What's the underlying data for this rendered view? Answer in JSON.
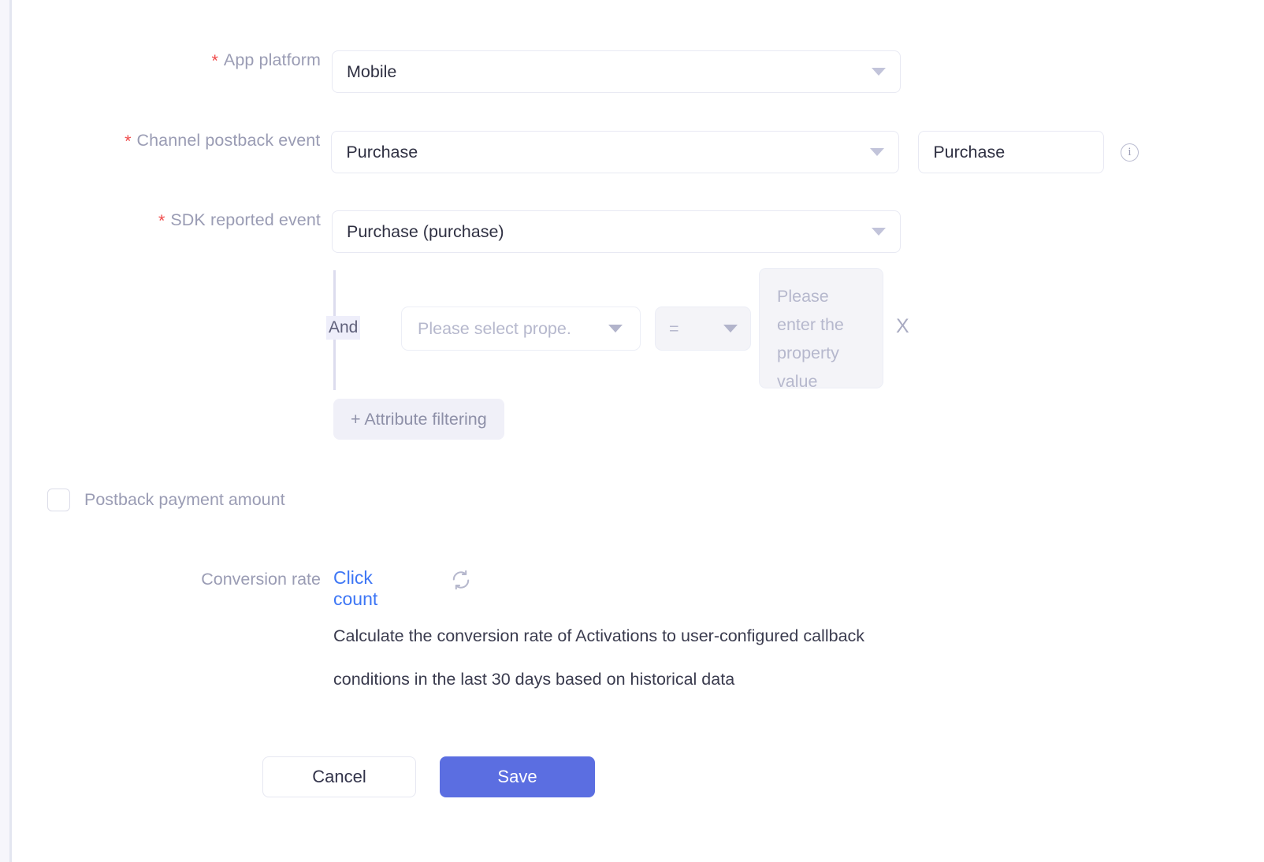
{
  "theme": {
    "accent": "#5b6ee1",
    "link": "#3d76f5",
    "required_star": "#f04a4a",
    "label_text": "#9a9cb4",
    "body_text": "#3a3b4e",
    "border": "#e8e9f3",
    "muted_fill": "#f4f4f8",
    "badge_fill": "#eeeefa"
  },
  "form": {
    "app_platform": {
      "label": "App platform",
      "required": true,
      "star": "*",
      "value": "Mobile",
      "caret_icon": "chevron-down-icon"
    },
    "channel_postback_event": {
      "label": "Channel postback event",
      "required": true,
      "star": "*",
      "value": "Purchase",
      "caret_icon": "chevron-down-icon",
      "alias_value": "Purchase",
      "alias_placeholder": "Purchase",
      "info_icon": "info-icon",
      "info_glyph": "i"
    },
    "sdk_reported_event": {
      "label": "SDK reported event",
      "required": true,
      "star": "*",
      "value": "Purchase (purchase)",
      "caret_icon": "chevron-down-icon"
    },
    "attribute_filter": {
      "conjunction": "And",
      "property_placeholder": "Please select prope.",
      "property_caret_icon": "chevron-down-icon",
      "operator_value": "=",
      "operator_caret_icon": "chevron-down-icon",
      "value_placeholder": "Please enter the property value",
      "remove_label": "X",
      "remove_icon": "close-icon",
      "add_button_label": "+ Attribute filtering"
    },
    "postback_payment_amount": {
      "label": "Postback payment amount",
      "checked": false,
      "checkbox_icon": "checkbox-unchecked-icon"
    },
    "conversion_rate": {
      "label": "Conversion rate",
      "link_label": "Click count",
      "refresh_icon": "refresh-icon",
      "description": "Calculate the conversion rate of Activations to user-configured callback conditions in the last 30 days based on historical data"
    }
  },
  "footer": {
    "cancel_label": "Cancel",
    "save_label": "Save"
  }
}
